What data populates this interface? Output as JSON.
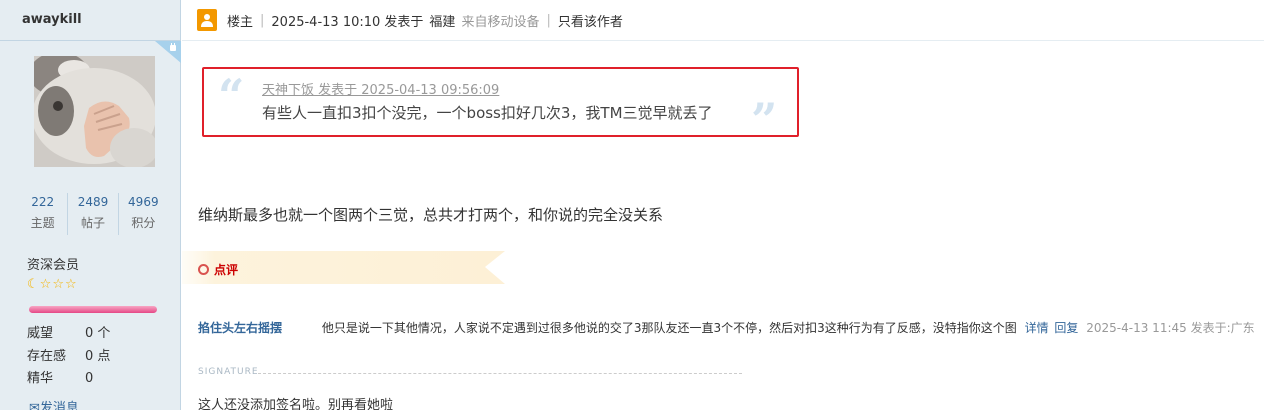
{
  "author": {
    "name": "awaykill",
    "stats": [
      {
        "value": "222",
        "label": "主题"
      },
      {
        "value": "2489",
        "label": "帖子"
      },
      {
        "value": "4969",
        "label": "积分"
      }
    ],
    "level": "资深会员",
    "credits": [
      {
        "label": "威望",
        "value": "0 个"
      },
      {
        "label": "存在感",
        "value": "0 点"
      },
      {
        "label": "精华",
        "value": "0"
      }
    ],
    "send_message": "发消息"
  },
  "post_header": {
    "role": "楼主",
    "date": "2025-4-13 10:10 发表于",
    "location": "福建",
    "device": "来自移动设备",
    "only_author": "只看该作者"
  },
  "quote": {
    "meta": "天神下饭 发表于 2025-04-13 09:56:09",
    "text": "有些人一直扣3扣个没完，一个boss扣好几次3，我TM三觉早就丢了"
  },
  "body": "维纳斯最多也就一个图两个三觉，总共才打两个，和你说的完全没关系",
  "comment_section": {
    "label": "点评",
    "comment": {
      "author": "掐住头左右摇摆",
      "text": "他只是说一下其他情况，人家说不定遇到过很多他说的交了3那队友还一直3个不停，然后对扣3这种行为有了反感，没特指你这个图",
      "detail_link": "详情",
      "reply_link": "回复",
      "time": "2025-4-13 11:45 发表于:广东"
    }
  },
  "signature": {
    "label": "SIGNATURE",
    "text": "这人还没添加签名啦。别再看她啦"
  },
  "colors": {
    "accent": "#336699",
    "highlight_border": "#e0202a",
    "sidebar_bg": "#e5edf2"
  }
}
